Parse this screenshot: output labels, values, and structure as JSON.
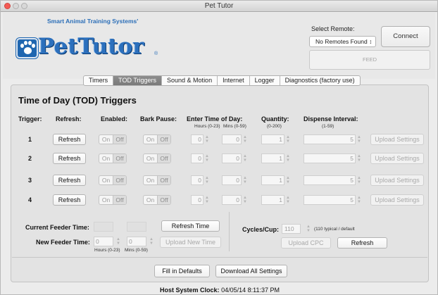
{
  "window": {
    "title": "Pet Tutor"
  },
  "brand": {
    "company": "Smart Animal Training Systems'",
    "logo": "PetTutor",
    "registered": "®"
  },
  "remote": {
    "label": "Select Remote:",
    "selected": "No Remotes Found ↕",
    "connect_label": "Connect",
    "feed_label": "FEED"
  },
  "tabs": [
    {
      "label": "Timers",
      "active": false
    },
    {
      "label": "TOD Triggers",
      "active": true
    },
    {
      "label": "Sound & Motion",
      "active": false
    },
    {
      "label": "Internet",
      "active": false
    },
    {
      "label": "Logger",
      "active": false
    },
    {
      "label": "Diagnostics (factory use)",
      "active": false
    }
  ],
  "section": {
    "title": "Time of Day (TOD) Triggers"
  },
  "columns": {
    "trigger": "Trigger:",
    "refresh": "Refresh:",
    "enabled": "Enabled:",
    "bark_pause": "Bark Pause:",
    "enter_time": "Enter Time of Day:",
    "hours_sub": "Hours (0-23)",
    "mins_sub": "Mins (0-59)",
    "quantity": "Quantity:",
    "quantity_sub": "(0-200)",
    "interval": "Dispense Interval:",
    "interval_sub": "(1-59)"
  },
  "triggers": [
    {
      "num": "1",
      "refresh": "Refresh",
      "on": "On",
      "off": "Off",
      "bp_on": "On",
      "bp_off": "Off",
      "hours": "0",
      "mins": "0",
      "quantity": "1",
      "interval": "5",
      "upload": "Upload Settings"
    },
    {
      "num": "2",
      "refresh": "Refresh",
      "on": "On",
      "off": "Off",
      "bp_on": "On",
      "bp_off": "Off",
      "hours": "0",
      "mins": "0",
      "quantity": "1",
      "interval": "5",
      "upload": "Upload Settings"
    },
    {
      "num": "3",
      "refresh": "Refresh",
      "on": "On",
      "off": "Off",
      "bp_on": "On",
      "bp_off": "Off",
      "hours": "0",
      "mins": "0",
      "quantity": "1",
      "interval": "5",
      "upload": "Upload Settings"
    },
    {
      "num": "4",
      "refresh": "Refresh",
      "on": "On",
      "off": "Off",
      "bp_on": "On",
      "bp_off": "Off",
      "hours": "0",
      "mins": "0",
      "quantity": "1",
      "interval": "5",
      "upload": "Upload Settings"
    }
  ],
  "feeder": {
    "current_label": "Current Feeder Time:",
    "refresh_time": "Refresh Time",
    "new_label": "New Feeder Time:",
    "new_hours": "0",
    "new_mins": "0",
    "hours_sub": "Hours (0-23)",
    "mins_sub": "Mins (0-59)",
    "upload_time": "Upload New Time"
  },
  "cycles": {
    "label": "Cycles/Cup:",
    "value": "110",
    "note": "(110 typical / default",
    "upload": "Upload CPC",
    "refresh": "Refresh"
  },
  "actions": {
    "fill_defaults": "Fill in Defaults",
    "download_all": "Download All Settings"
  },
  "clock": {
    "label": "Host System Clock:",
    "value": "04/05/14 8:11:37 PM"
  },
  "colors": {
    "brand_blue": "#2c70bd",
    "active_tab": "#858585",
    "close": "#f45b55"
  }
}
